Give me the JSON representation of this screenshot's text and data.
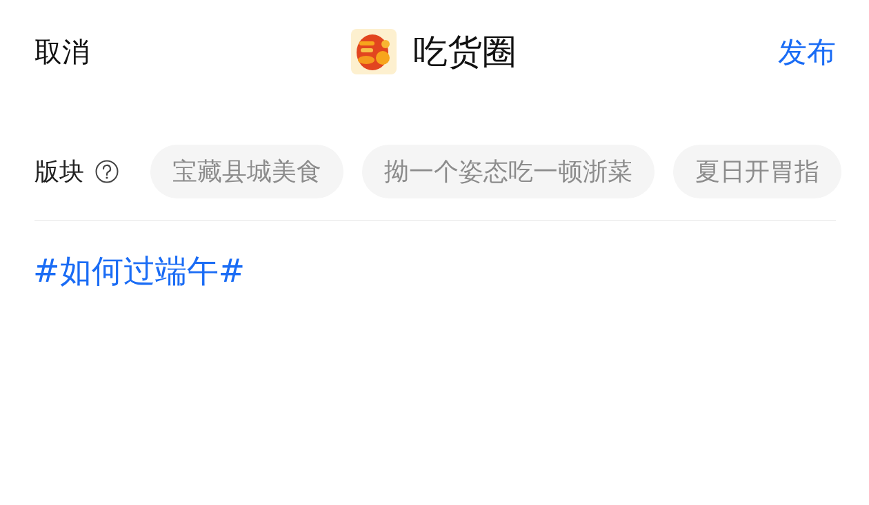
{
  "header": {
    "cancel": "取消",
    "title": "吃货圈",
    "publish": "发布"
  },
  "section": {
    "label": "版块",
    "chips": [
      {
        "label": "宝藏县城美食",
        "selected": false
      },
      {
        "label": "拗一个姿态吃一顿浙菜",
        "selected": false
      },
      {
        "label": "夏日开胃指",
        "selected": false
      }
    ]
  },
  "content": {
    "hashtag": "#如何过端午#"
  }
}
